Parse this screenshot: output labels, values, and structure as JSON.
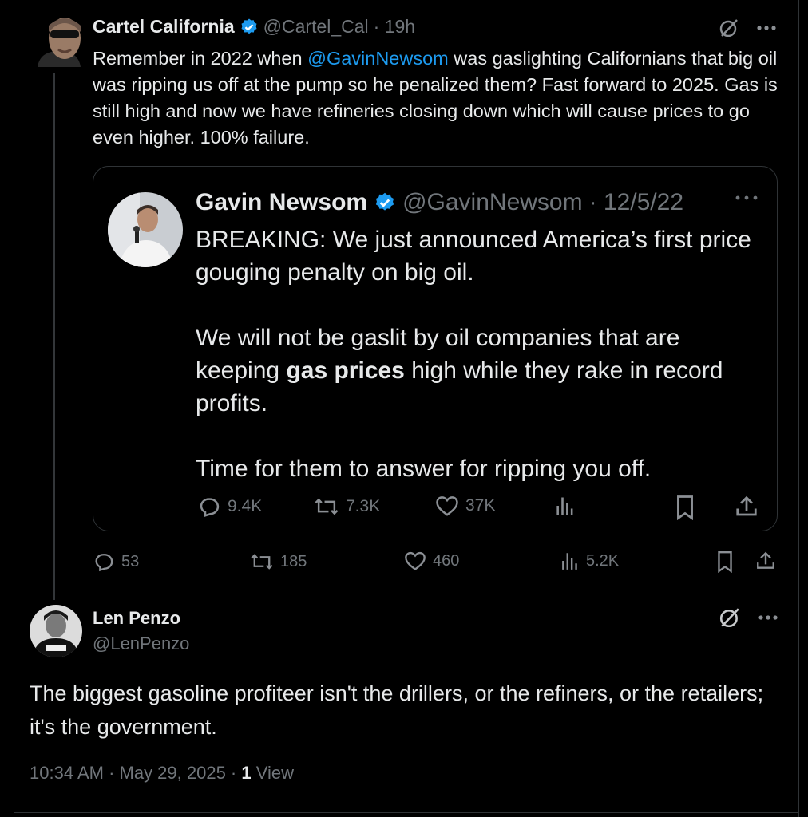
{
  "main_post": {
    "author_name": "Cartel California",
    "handle": "@Cartel_Cal",
    "time": "· 19h",
    "text_before_mention": "Remember in 2022 when ",
    "mention": "@GavinNewsom",
    "text_after_mention": " was gaslighting Californians that big oil was ripping us off at the pump so he penalized them? Fast forward to 2025. Gas is still high and now we have refineries closing down which will cause prices to go even higher. 100% failure.",
    "stats": {
      "replies": "53",
      "reposts": "185",
      "likes": "460",
      "views": "5.2K"
    }
  },
  "quoted_post": {
    "author_name": "Gavin Newsom",
    "handle": "@GavinNewsom",
    "date": "· 12/5/22",
    "line1": "BREAKING: We just announced America’s first price gouging penalty on big oil.",
    "line2_before_bold": "We will not be gaslit by oil companies that are keeping ",
    "line2_bold": "gas prices",
    "line2_after_bold": " high while they rake in record profits.",
    "line3": "Time for them to answer for ripping you off.",
    "stats": {
      "replies": "9.4K",
      "reposts": "7.3K",
      "likes": "37K"
    }
  },
  "reply_post": {
    "author_name": "Len Penzo",
    "handle": "@LenPenzo",
    "text": "The biggest gasoline profiteer isn't the drillers, or the refiners, or the retailers; it's the government.",
    "timestamp": "10:34 AM · May 29, 2025 · ",
    "view_count": "1",
    "view_label": " View"
  },
  "colors": {
    "background": "#000000",
    "text": "#e7e9ea",
    "muted": "#71767b",
    "link": "#1d9bf0",
    "border": "#2f3336"
  }
}
